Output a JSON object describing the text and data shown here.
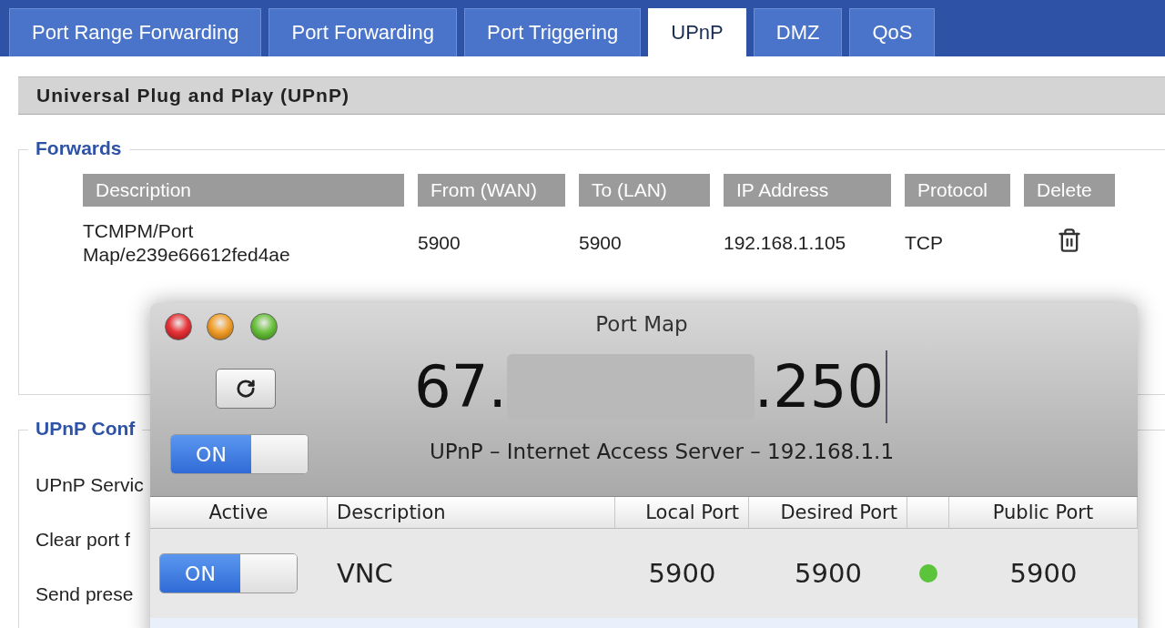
{
  "tabs": [
    {
      "label": "Port Range Forwarding",
      "selected": false
    },
    {
      "label": "Port Forwarding",
      "selected": false
    },
    {
      "label": "Port Triggering",
      "selected": false
    },
    {
      "label": "UPnP",
      "selected": true
    },
    {
      "label": "DMZ",
      "selected": false
    },
    {
      "label": "QoS",
      "selected": false
    }
  ],
  "section_title": "Universal Plug and Play (UPnP)",
  "forwards": {
    "legend": "Forwards",
    "columns": [
      "Description",
      "From (WAN)",
      "To (LAN)",
      "IP Address",
      "Protocol",
      "Delete"
    ],
    "rows": [
      {
        "description": "TCMPM/Port Map/e239e66612fed4ae",
        "from_wan": "5900",
        "to_lan": "5900",
        "ip_address": "192.168.1.105",
        "protocol": "TCP"
      }
    ]
  },
  "config": {
    "legend": "UPnP Conf",
    "rows": [
      "UPnP Servic",
      "Clear port f",
      "Send prese"
    ]
  },
  "port_map": {
    "title": "Port Map",
    "ip_start": "67.",
    "ip_end": ".250",
    "service_on": true,
    "service_label": "ON",
    "server": "UPnP – Internet Access Server – 192.168.1.1",
    "columns": [
      "Active",
      "Description",
      "Local Port",
      "Desired Port",
      "Public Port"
    ],
    "rows": [
      {
        "active": true,
        "toggle_label": "ON",
        "description": "VNC",
        "local_port": "5900",
        "desired_port": "5900",
        "color": "#5cc43a",
        "public_port": "5900"
      }
    ]
  }
}
